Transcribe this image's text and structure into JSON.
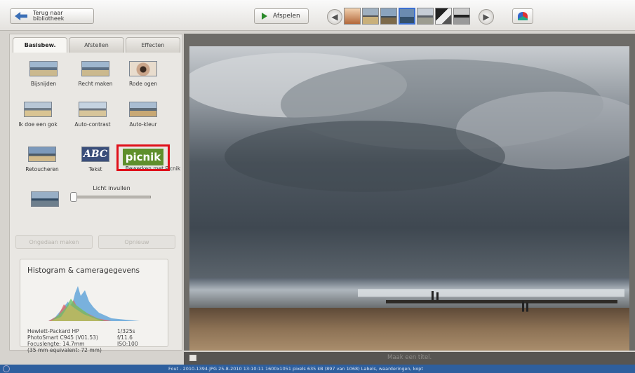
{
  "toolbar": {
    "back_label_line1": "Terug naar",
    "back_label_line2": "bibliotheek",
    "play_label": "Afspelen"
  },
  "tabs": [
    "Basisbew.",
    "Afstellen",
    "Effecten"
  ],
  "tools": [
    {
      "label": "Bijsnijden",
      "icon": "crop-icon"
    },
    {
      "label": "Recht maken",
      "icon": "straighten-icon"
    },
    {
      "label": "Rode ogen",
      "icon": "red-eye-icon"
    },
    {
      "label": "Ik doe een gok",
      "icon": "auto-fix-icon"
    },
    {
      "label": "Auto-contrast",
      "icon": "auto-contrast-icon"
    },
    {
      "label": "Auto-kleur",
      "icon": "auto-color-icon"
    },
    {
      "label": "Retoucheren",
      "icon": "retouch-icon"
    },
    {
      "label": "Tekst",
      "icon": "text-icon"
    },
    {
      "label": "Bewerken met Picnik",
      "icon": "picnik-icon"
    }
  ],
  "picnik_logo": "picnik",
  "abc_text": "ABC",
  "fill_light": {
    "label": "Licht invullen",
    "level": 0
  },
  "buttons": {
    "undo": "Ongedaan maken",
    "redo": "Opnieuw"
  },
  "histogram": {
    "title": "Histogram & cameragegevens",
    "camera_lines": [
      "Hewlett-Packard HP",
      "PhotoSmart C945 (V01.53)",
      "Focuslengte: 14.7mm",
      "(35 mm equivalent: 72 mm)"
    ],
    "exposure_lines": [
      "1/325s",
      "f/11.6",
      "ISO:100"
    ]
  },
  "photo_title_placeholder": "Maak een titel.",
  "status_text": "Fout - 2010-1394.JPG    25-8-2010 13:10:11    1600x1051 pixels    635 kB    (897 van 1068)    Labels, waarderingen, kopt"
}
